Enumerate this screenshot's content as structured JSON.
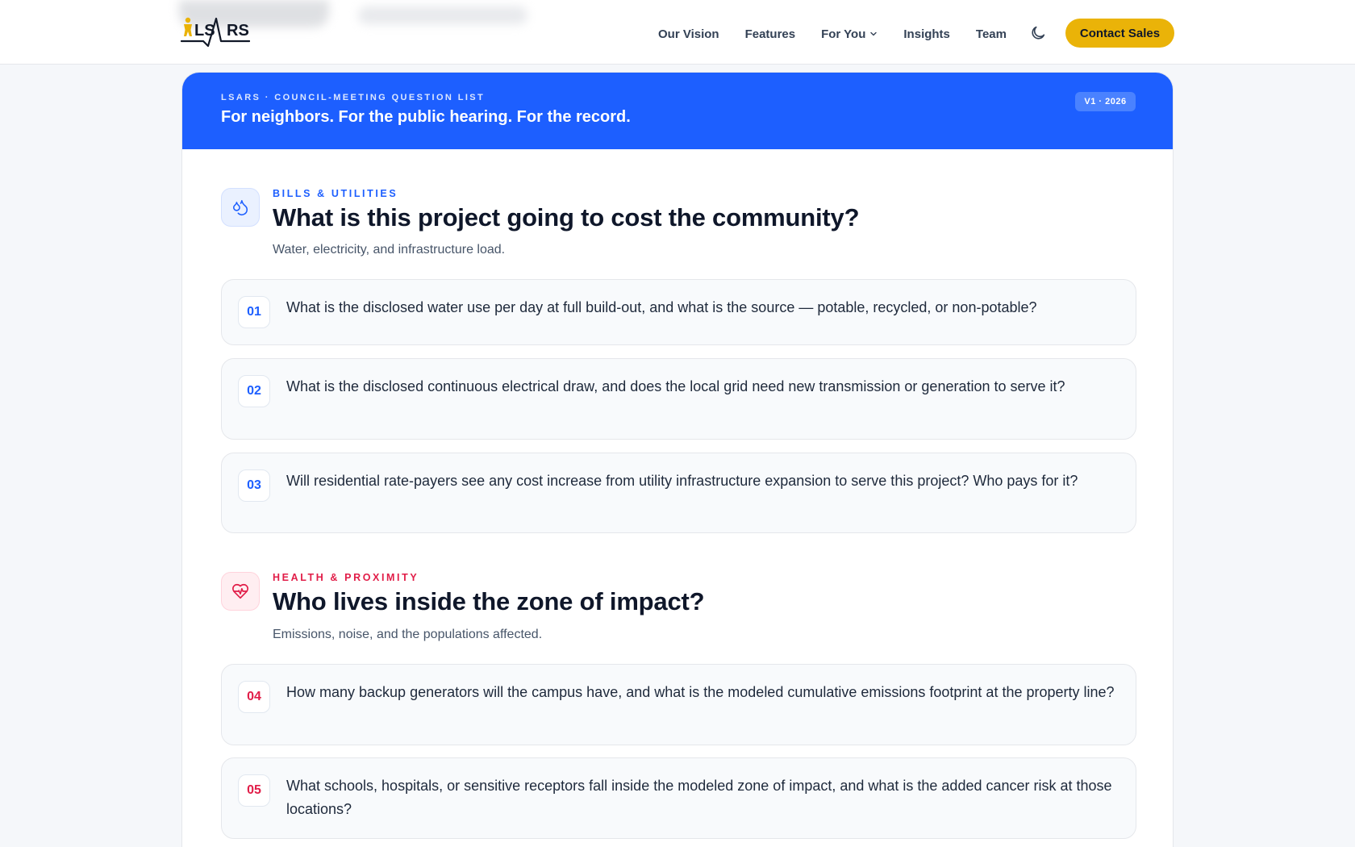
{
  "header": {
    "logo_text": "LSARS",
    "nav": [
      {
        "label": "Our Vision"
      },
      {
        "label": "Features"
      },
      {
        "label": "For You",
        "has_dropdown": true,
        "icon": "chevron-down-icon"
      },
      {
        "label": "Insights"
      },
      {
        "label": "Team"
      }
    ],
    "theme_toggle_icon": "moon-icon",
    "cta_label": "Contact Sales",
    "colors": {
      "cta": "#eab308",
      "brand_yellow": "#eab308"
    }
  },
  "banner": {
    "kicker": "LSARS · COUNCIL-MEETING QUESTION LIST",
    "title": "For neighbors. For the public hearing. For the record.",
    "version": "V1 · 2026",
    "color": "#1d5fff"
  },
  "sections": [
    {
      "icon": "droplets-icon",
      "kicker": "BILLS & UTILITIES",
      "title": "What is this project going to cost the community?",
      "subtitle": "Water, electricity, and infrastructure load.",
      "accent": "#1d5fff",
      "questions": [
        {
          "num": "01",
          "text": "What is the disclosed water use per day at full build-out, and what is the source — potable, recycled, or non-potable?"
        },
        {
          "num": "02",
          "text": "What is the disclosed continuous electrical draw, and does the local grid need new transmission or generation to serve it?"
        },
        {
          "num": "03",
          "text": "Will residential rate-payers see any cost increase from utility infrastructure expansion to serve this project? Who pays for it?"
        }
      ]
    },
    {
      "icon": "heart-pulse-icon",
      "kicker": "HEALTH & PROXIMITY",
      "title": "Who lives inside the zone of impact?",
      "subtitle": "Emissions, noise, and the populations affected.",
      "accent": "#e11d48",
      "questions": [
        {
          "num": "04",
          "text": "How many backup generators will the campus have, and what is the modeled cumulative emissions footprint at the property line?"
        },
        {
          "num": "05",
          "text": "What schools, hospitals, or sensitive receptors fall inside the modeled zone of impact, and what is the added cancer risk at those locations?"
        }
      ]
    }
  ]
}
